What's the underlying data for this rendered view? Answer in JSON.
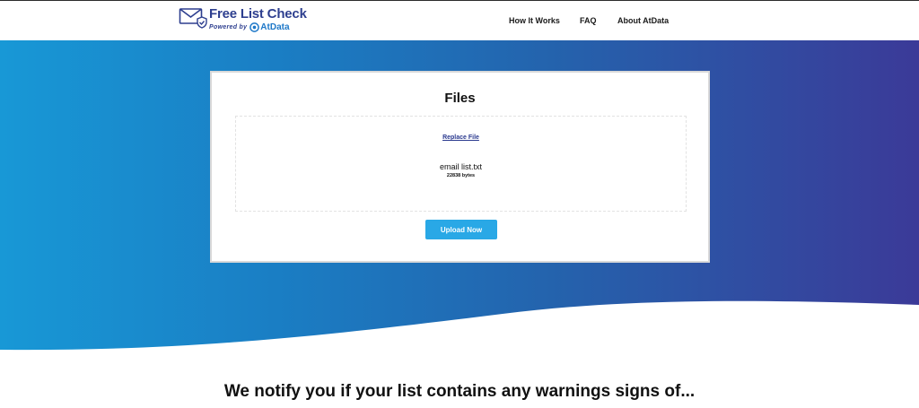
{
  "header": {
    "logo": {
      "title": "Free List Check",
      "powered_by": "Powered by",
      "partner": "AtData"
    },
    "nav": [
      {
        "label": "How It Works"
      },
      {
        "label": "FAQ"
      },
      {
        "label": "About AtData"
      }
    ]
  },
  "upload_card": {
    "title": "Files",
    "replace_link": "Replace File",
    "file_name": "email list.txt",
    "file_size": "22838 bytes",
    "upload_button": "Upload Now"
  },
  "section": {
    "heading": "We notify you if your list contains any warnings signs of..."
  },
  "colors": {
    "brand_navy": "#2e3f8f",
    "brand_blue": "#1e78c8",
    "button": "#29a8e6",
    "gradient_start": "#1898d6",
    "gradient_end": "#3b3a98"
  },
  "icons": [
    "envelope-check-icon",
    "atdata-logo-icon"
  ]
}
